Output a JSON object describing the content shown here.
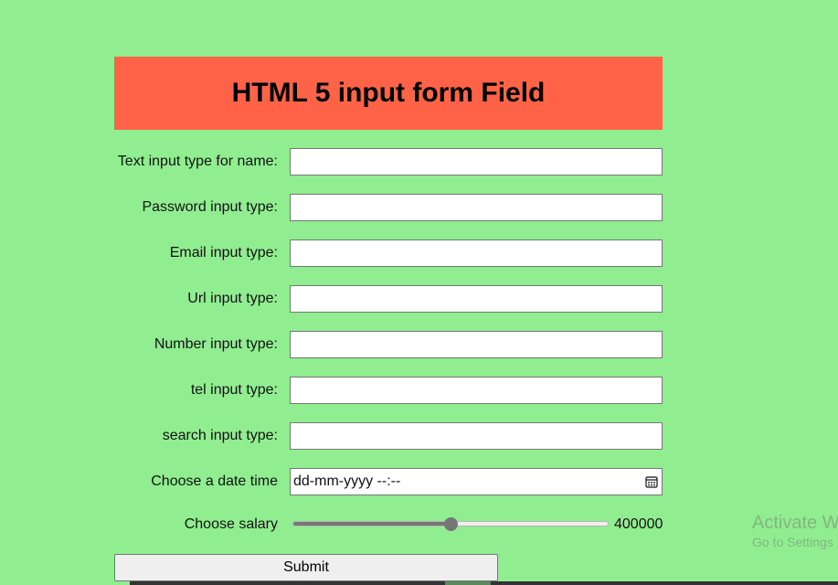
{
  "header": {
    "title": "HTML 5 input form Field",
    "background_color": "#ff6347"
  },
  "page": {
    "background_color": "#90ee90"
  },
  "form": {
    "name_label": "Text input type for name:",
    "name_value": "",
    "password_label": "Password input type:",
    "password_value": "",
    "email_label": "Email input type:",
    "email_value": "",
    "url_label": "Url input type:",
    "url_value": "",
    "number_label": "Number input type:",
    "number_value": "",
    "tel_label": "tel input type:",
    "tel_value": "",
    "search_label": "search input type:",
    "search_value": "",
    "datetime_label": "Choose a date time",
    "datetime_placeholder": "dd-mm-yyyy --:--",
    "datetime_icon": "calendar-icon",
    "salary_label": "Choose salary",
    "salary_value": "400000",
    "salary_slider_fraction": 0.5,
    "submit_label": "Submit"
  },
  "watermark": {
    "title": "Activate W",
    "subtitle": "Go to Settings"
  }
}
